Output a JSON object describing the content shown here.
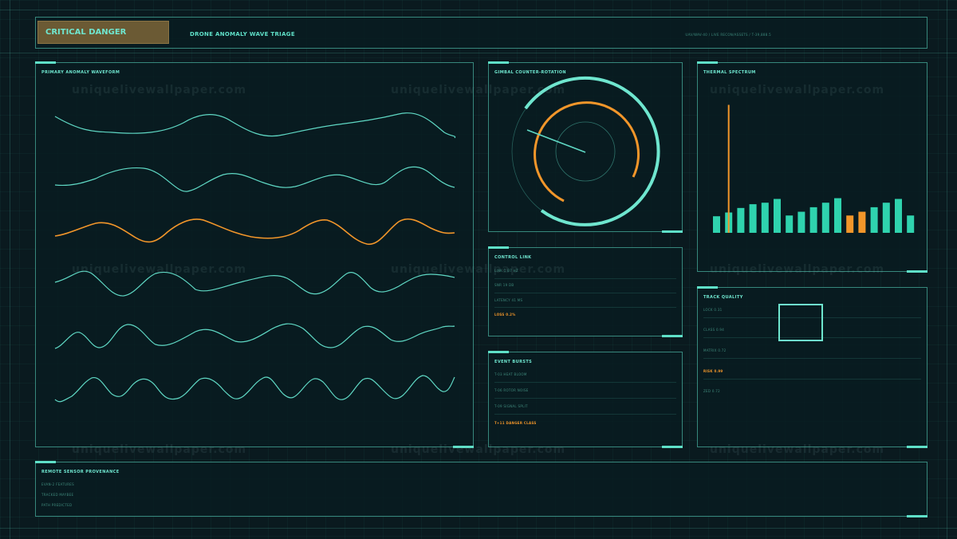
{
  "header": {
    "status": "CRITICAL DANGER",
    "title": "DRONE ANOMALY WAVE TRIAGE",
    "meta": "UAV/WAV-40 / LIVE RECON/ASSETS / T-39,888.5"
  },
  "waveform": {
    "title": "PRIMARY ANOMALY WAVEFORM"
  },
  "gimbal": {
    "title": "GIMBAL COUNTER-ROTATION"
  },
  "thermal": {
    "title": "THERMAL SPECTRUM",
    "chart_data": {
      "type": "bar",
      "values": [
        22,
        27,
        33,
        38,
        40,
        45,
        23,
        28,
        34,
        40,
        46,
        23,
        28,
        34,
        40,
        45,
        23
      ],
      "highlight": [
        11,
        12
      ],
      "spike_index": 1,
      "spike_value": 170,
      "ylim": [
        0,
        180
      ],
      "colors": {
        "normal": "#2fd3ae",
        "highlight": "#f2962a"
      }
    }
  },
  "control_link": {
    "title": "CONTROL LINK",
    "rows": [
      {
        "label": "LINK 1 B7 HZ",
        "warn": false
      },
      {
        "label": "SNR 19 DB",
        "warn": false
      },
      {
        "label": "LATENCY 41 MS",
        "warn": false
      },
      {
        "label": "LOSS 0.2%",
        "warn": true
      }
    ]
  },
  "event_bursts": {
    "title": "EVENT BURSTS",
    "rows": [
      {
        "label": "T-03 HEAT BLOOM",
        "warn": false
      },
      {
        "label": "T-06 ROTOR NOISE",
        "warn": false
      },
      {
        "label": "T-09 SIGNAL SPLIT",
        "warn": false
      },
      {
        "label": "T+11 DANGER CLASS",
        "warn": true
      }
    ]
  },
  "track_quality": {
    "title": "TRACK QUALITY",
    "rows": [
      {
        "label": "LOCK 0.31",
        "warn": false
      },
      {
        "label": "CLASS 0.94",
        "warn": false
      },
      {
        "label": "MATRIX 0.72",
        "warn": false
      },
      {
        "label": "RISK 0.99",
        "warn": true
      },
      {
        "label": "ZED 0.72",
        "warn": false
      }
    ]
  },
  "provenance": {
    "title": "REMOTE SENSOR PROVENANCE",
    "rows": [
      {
        "label": "EVAN-2 FEATURES"
      },
      {
        "label": "TRACKED MAYBEE"
      },
      {
        "label": "PATH PREDICTED"
      }
    ]
  },
  "watermark": "uniquelivewallpaper.com",
  "colors": {
    "accent": "#5fe0c8",
    "warn": "#f2962a",
    "badge": "#6b5a34",
    "bg": "#0a1a1f"
  }
}
